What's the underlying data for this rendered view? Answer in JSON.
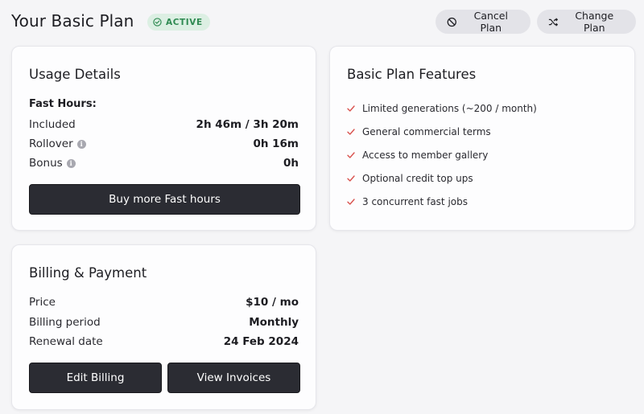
{
  "header": {
    "title": "Your Basic Plan",
    "status_badge": "ACTIVE",
    "cancel_label": "Cancel Plan",
    "change_label": "Change Plan"
  },
  "usage": {
    "title": "Usage Details",
    "subhead": "Fast Hours:",
    "rows": [
      {
        "label": "Included",
        "value": "2h 46m / 3h 20m"
      },
      {
        "label": "Rollover",
        "value": "0h 16m"
      },
      {
        "label": "Bonus",
        "value": "0h"
      }
    ],
    "buy_label": "Buy more Fast hours"
  },
  "features": {
    "title": "Basic Plan Features",
    "items": [
      "Limited generations (~200 / month)",
      "General commercial terms",
      "Access to member gallery",
      "Optional credit top ups",
      "3 concurrent fast jobs"
    ]
  },
  "billing": {
    "title": "Billing & Payment",
    "rows": [
      {
        "label": "Price",
        "value": "$10 / mo"
      },
      {
        "label": "Billing period",
        "value": "Monthly"
      },
      {
        "label": "Renewal date",
        "value": "24 Feb 2024"
      }
    ],
    "edit_label": "Edit Billing",
    "invoices_label": "View Invoices"
  },
  "colors": {
    "accent_check": "#d9534f",
    "badge_green": "#2f8a52",
    "dark_button": "#2b2c33"
  },
  "icons": {
    "badge": "check-circle-icon",
    "cancel": "ban-icon",
    "change": "shuffle-icon",
    "info": "info-icon",
    "feature": "check-icon"
  }
}
